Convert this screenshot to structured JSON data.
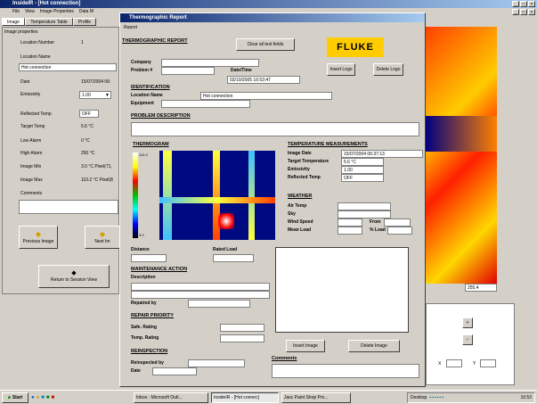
{
  "main_window": {
    "title": "InsideIR - [Hot connection]",
    "menu": [
      "File",
      "View",
      "Image Properties",
      "Data M"
    ],
    "tabs": [
      "Image",
      "Temperature Table",
      "Profile"
    ]
  },
  "props": {
    "section": "Image properties",
    "rows": [
      {
        "label": "Location Number",
        "value": "1"
      },
      {
        "label": "Location Name",
        "value": ""
      },
      {
        "label": "",
        "value": "Hot connection"
      },
      {
        "label": "Date",
        "value": "15/07/2004 06:"
      },
      {
        "label": "Emissivity",
        "value": "1.00"
      },
      {
        "label": "Reflected Temp",
        "value": "OFF"
      },
      {
        "label": "Target Temp",
        "value": "5.6 °C"
      },
      {
        "label": "Low Alarm",
        "value": "0 °C"
      },
      {
        "label": "High Alarm",
        "value": "250 °C"
      },
      {
        "label": "Image Min",
        "value": "3.0 °C  Pixel(71,"
      },
      {
        "label": "Image Max",
        "value": "110.2 °C  Pixel(8"
      },
      {
        "label": "Comments",
        "value": ""
      }
    ],
    "prev_label": "Previous Image",
    "next_label": "Next Im",
    "return_label": "Return to Session View"
  },
  "dialog": {
    "title": "Thermographic Report",
    "menu": "Report",
    "heading": "THERMOGRAPHIC REPORT",
    "clear_label": "Clear all text fields",
    "logo": "FLUKE",
    "insert_logo": "Insert Logo",
    "delete_logo": "Delete Logo",
    "company": "Company",
    "problem": "Problem #",
    "date_time_label": "Date/Time",
    "date_time_value": "03/10/2005 16:53:47",
    "identification": "IDENTIFICATION",
    "location_name": "Location Name",
    "location_value": "Hot connection",
    "equipment": "Equipment",
    "problem_desc": "PROBLEM DESCRIPTION",
    "thermogram": "THERMOGRAM",
    "scale_top": "110.2",
    "scale_bot": "3.0",
    "temp_meas": "TEMPERATURE MEASUREMENTS",
    "meas": [
      {
        "label": "Image Date",
        "value": "15/07/2004 06:37:13"
      },
      {
        "label": "Target Temperature",
        "value": "5.6 °C"
      },
      {
        "label": "Emissivity",
        "value": "1.00"
      },
      {
        "label": "Reflected Temp",
        "value": "OFF"
      }
    ],
    "weather": "WEATHER",
    "air_temp": "Air Temp",
    "sky": "Sky",
    "wind_speed": "Wind Speed",
    "from": "From",
    "mean_load": "Mean Load",
    "pct_load": "% Load",
    "distance": "Distance",
    "rated_load": "Rated Load",
    "maintenance": "MAINTENANCE ACTION",
    "description": "Description",
    "repaired_by": "Repaired by",
    "repair_priority": "REPAIR PRIORITY",
    "safe_rating": "Safe. Rating",
    "temp_rating": "Temp. Rating",
    "reinspection": "REINSPECTION",
    "reinspected_by": "Reinspected by",
    "date": "Date",
    "insert_image": "Insert Image",
    "delete_image": "Delete Image",
    "comments": "Comments"
  },
  "right": {
    "scale_val": "255.4",
    "x_label": "X",
    "y_label": "Y"
  },
  "taskbar": {
    "start": "Start",
    "items": [
      "Inbox - Microsoft Outl...",
      "InsideIR - [Hot connec]",
      "Jasc Paint Shop Pro..."
    ],
    "desktop": "Desktop",
    "time": "16:53"
  },
  "colors": {
    "titlebar": "#0a246a",
    "fluke_yellow": "#ffcc00",
    "taskbar": "#d4d0c8"
  }
}
